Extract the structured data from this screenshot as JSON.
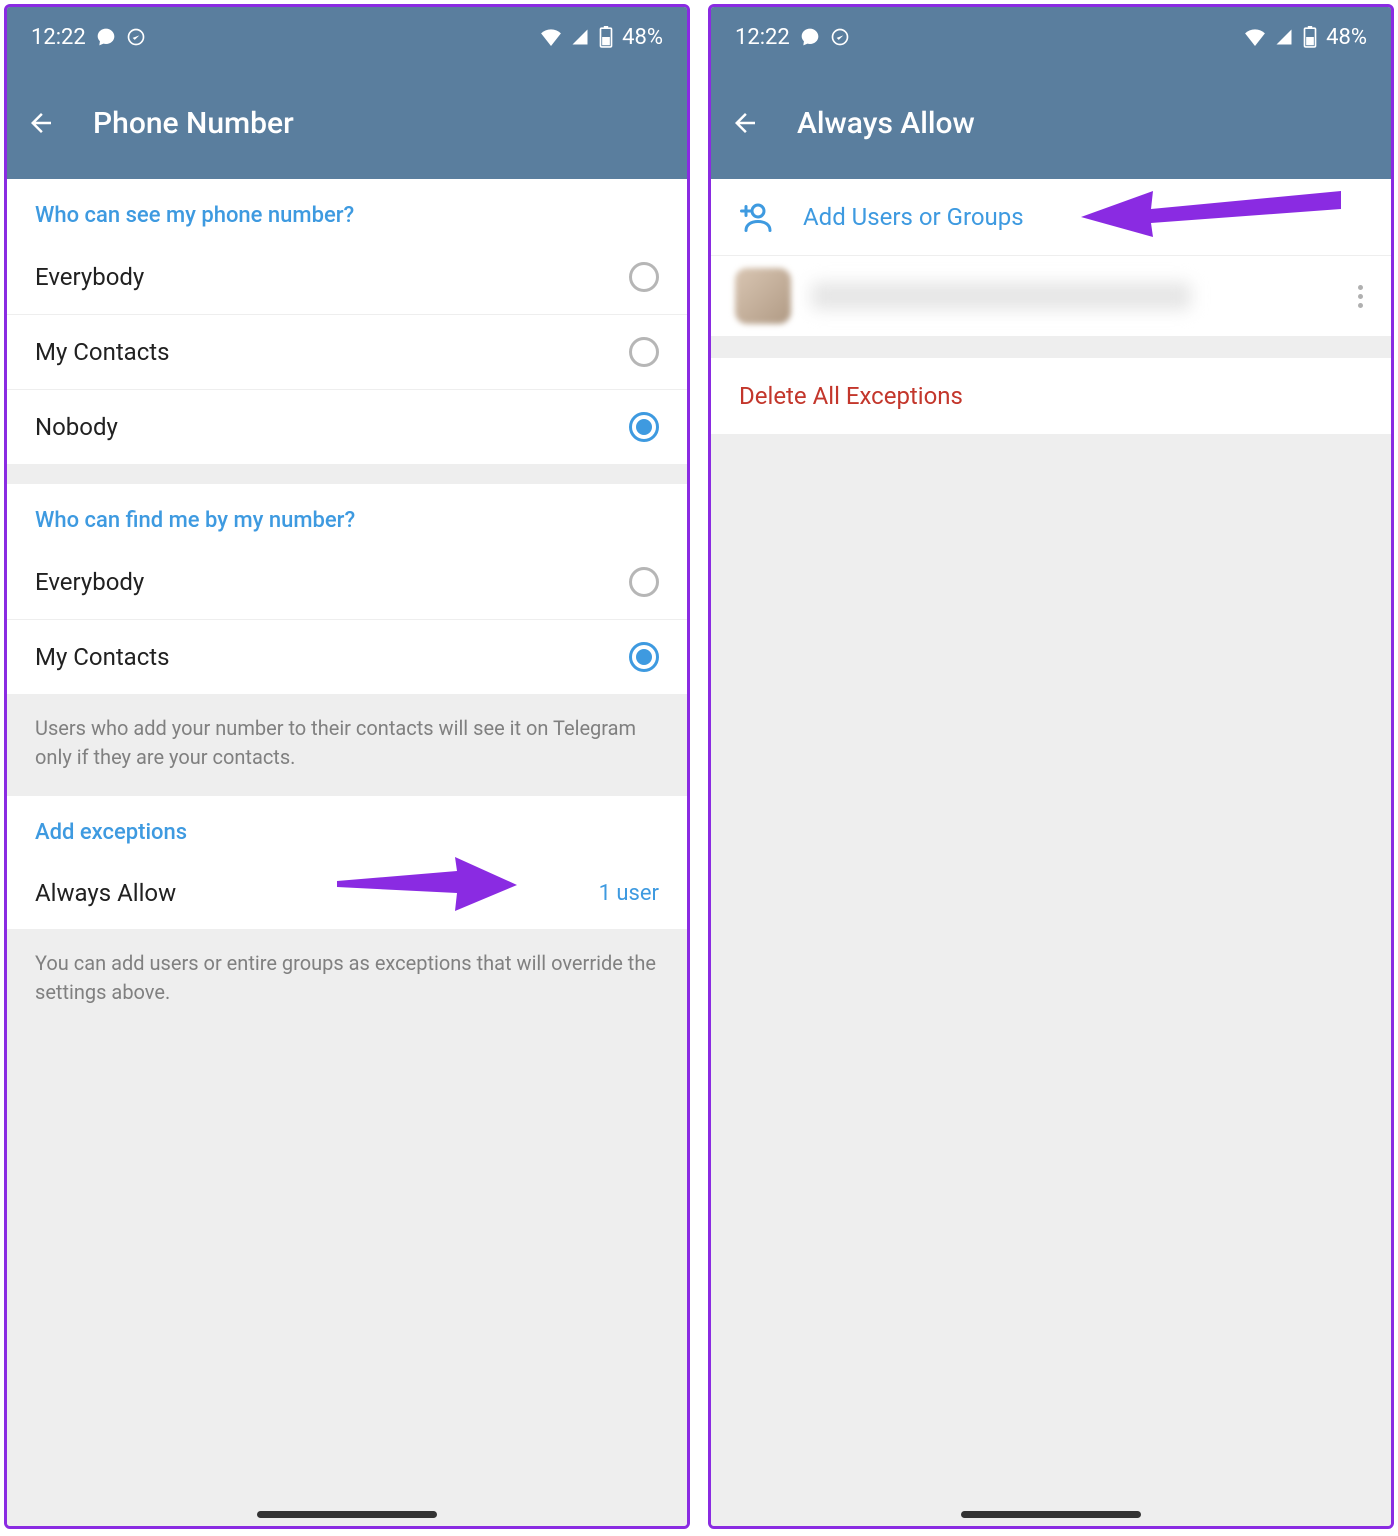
{
  "status": {
    "time": "12:22",
    "battery": "48%"
  },
  "left": {
    "title": "Phone Number",
    "section1": {
      "header": "Who can see my phone number?",
      "options": [
        "Everybody",
        "My Contacts",
        "Nobody"
      ],
      "selected": 2
    },
    "section2": {
      "header": "Who can find me by my number?",
      "options": [
        "Everybody",
        "My Contacts"
      ],
      "selected": 1,
      "info": "Users who add your number to their contacts will see it on Telegram only if they are your contacts."
    },
    "section3": {
      "header": "Add exceptions",
      "row_label": "Always Allow",
      "row_value": "1 user",
      "info": "You can add users or entire groups as exceptions that will override the settings above."
    }
  },
  "right": {
    "title": "Always Allow",
    "add_label": "Add Users or Groups",
    "delete_label": "Delete All Exceptions"
  }
}
